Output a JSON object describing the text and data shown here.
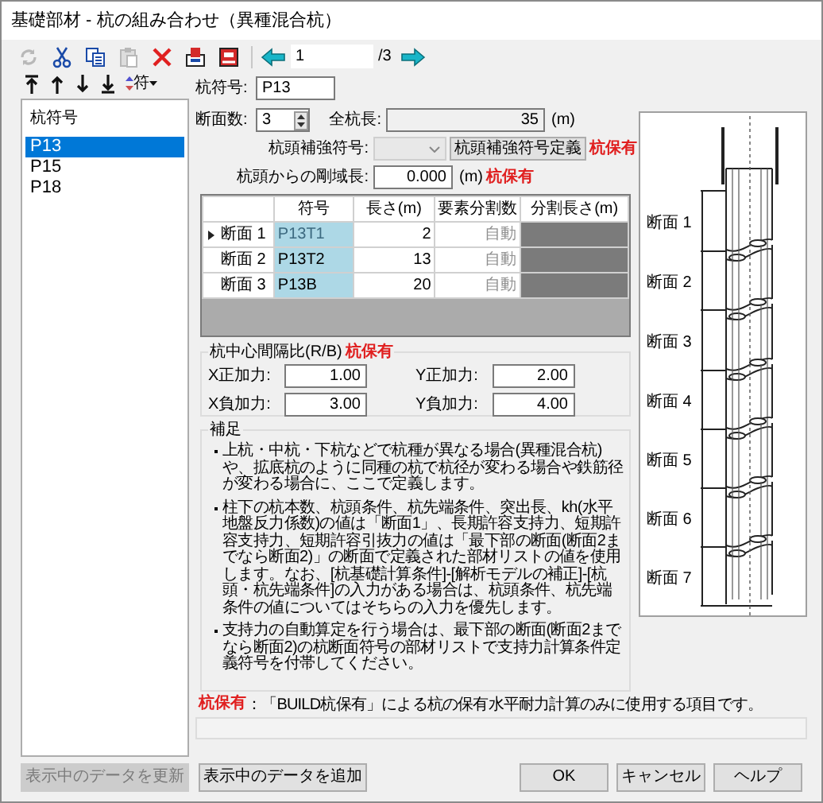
{
  "window": {
    "title": "基礎部材 - 杭の組み合わせ（異種混合杭）"
  },
  "toolbar": {
    "tools": [
      {
        "kind": "refresh",
        "disabled": true
      },
      {
        "kind": "cut",
        "disabled": false
      },
      {
        "kind": "copy",
        "disabled": false
      },
      {
        "kind": "paste",
        "disabled": true
      },
      {
        "kind": "delete",
        "disabled": false
      },
      {
        "kind": "import",
        "disabled": false
      },
      {
        "kind": "export",
        "disabled": false
      }
    ],
    "page": "1",
    "page_total": "/3"
  },
  "sort_button": {
    "label": "符"
  },
  "pile_list": {
    "header": "杭符号",
    "items": [
      {
        "label": "P13",
        "selected": true
      },
      {
        "label": "P15",
        "selected": false
      },
      {
        "label": "P18",
        "selected": false
      }
    ]
  },
  "form": {
    "pile_code_label": "杭符号:",
    "pile_code": "P13",
    "section_count_label": "断面数:",
    "section_count": "3",
    "total_length_label": "全杭長:",
    "total_length": "35",
    "total_length_unit": "(m)",
    "head_reinforcement_label": "杭頭補強符号:",
    "head_reinforcement_disabled": true,
    "head_reinforcement_button": "杭頭補強符号定義",
    "head_reinforcement_badge": "杭保有",
    "rigid_zone_label": "杭頭からの剛域長:",
    "rigid_zone": "0.000",
    "rigid_zone_unit": "(m)",
    "rigid_zone_badge": "杭保有"
  },
  "sections_table": {
    "columns": [
      "符号",
      "長さ(m)",
      "要素分割数",
      "分割長さ(m)"
    ],
    "rows": [
      {
        "label": "断面 1",
        "code": "P13T1",
        "length": "2",
        "divisions": "自動",
        "selected": true
      },
      {
        "label": "断面 2",
        "code": "P13T2",
        "length": "13",
        "divisions": "自動",
        "selected": false
      },
      {
        "label": "断面 3",
        "code": "P13B",
        "length": "20",
        "divisions": "自動",
        "selected": false
      }
    ]
  },
  "spacing_ratio": {
    "title": "杭中心間隔比(R/B)",
    "badge": "杭保有",
    "fields": [
      {
        "label": "X正加力:",
        "value": "1.00"
      },
      {
        "label": "Y正加力:",
        "value": "2.00"
      },
      {
        "label": "X負加力:",
        "value": "3.00"
      },
      {
        "label": "Y負加力:",
        "value": "4.00"
      }
    ]
  },
  "notes": {
    "title": "補足",
    "items": [
      "上杭・中杭・下杭などで杭種が異なる場合(異種混合杭)や、拡底杭のように同種の杭で杭径が変わる場合や鉄筋径が変わる場合に、ここで定義します。",
      "柱下の杭本数、杭頭条件、杭先端条件、突出長、kh(水平地盤反力係数)の値は「断面1」、長期許容支持力、短期許容支持力、短期許容引抜力の値は「最下部の断面(断面2までなら断面2)」の断面で定義された部材リストの値を使用します。なお、[杭基礎計算条件]-[解析モデルの補正]-[杭頭・杭先端条件]の入力がある場合は、杭頭条件、杭先端条件の値についてはそちらの入力を優先します。",
      "支持力の自動算定を行う場合は、最下部の断面(断面2までなら断面2)の杭断面符号の部材リストで支持力計算条件定義符号を付帯してください。"
    ]
  },
  "legend": {
    "badge": "杭保有",
    "text": "：「BUILD杭保有」による杭の保有水平耐力計算のみに使用する項目です。"
  },
  "drawing": {
    "section_labels": [
      "断面 1",
      "断面 2",
      "断面 3",
      "断面 4",
      "断面 5",
      "断面 6",
      "断面 7"
    ]
  },
  "left_buttons": [
    {
      "label": "表示中のデータを更新",
      "disabled": true
    },
    {
      "label": "表示中のデータを追加",
      "disabled": false
    }
  ],
  "right_buttons": [
    {
      "label": "OK",
      "disabled": false
    },
    {
      "label": "キャンセル",
      "disabled": false
    },
    {
      "label": "ヘルプ",
      "disabled": false
    }
  ]
}
